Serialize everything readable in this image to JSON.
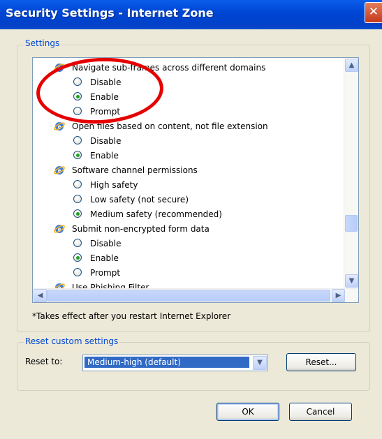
{
  "window": {
    "title": "Security Settings - Internet Zone",
    "close_glyph": "✕"
  },
  "settings_group": {
    "legend": "Settings",
    "categories": [
      {
        "label": "Navigate sub-frames across different domains",
        "options": [
          {
            "label": "Disable",
            "checked": false
          },
          {
            "label": "Enable",
            "checked": true
          },
          {
            "label": "Prompt",
            "checked": false
          }
        ]
      },
      {
        "label": "Open files based on content, not file extension",
        "options": [
          {
            "label": "Disable",
            "checked": false
          },
          {
            "label": "Enable",
            "checked": true
          }
        ]
      },
      {
        "label": "Software channel permissions",
        "options": [
          {
            "label": "High safety",
            "checked": false
          },
          {
            "label": "Low safety (not secure)",
            "checked": false
          },
          {
            "label": "Medium safety (recommended)",
            "checked": true
          }
        ]
      },
      {
        "label": "Submit non-encrypted form data",
        "options": [
          {
            "label": "Disable",
            "checked": false
          },
          {
            "label": "Enable",
            "checked": true
          },
          {
            "label": "Prompt",
            "checked": false
          }
        ]
      },
      {
        "label": "Use Phishing Filter",
        "options": []
      }
    ],
    "note": "*Takes effect after you restart Internet Explorer"
  },
  "reset_group": {
    "legend": "Reset custom settings",
    "reset_to_label": "Reset to:",
    "selected": "Medium-high (default)",
    "reset_button": "Reset..."
  },
  "footer": {
    "ok": "OK",
    "cancel": "Cancel"
  },
  "colors": {
    "accent": "#0046d5",
    "annotation": "#e60000"
  },
  "annotation": {
    "shape": "ellipse",
    "marks": "Navigate sub-frames radio options"
  }
}
